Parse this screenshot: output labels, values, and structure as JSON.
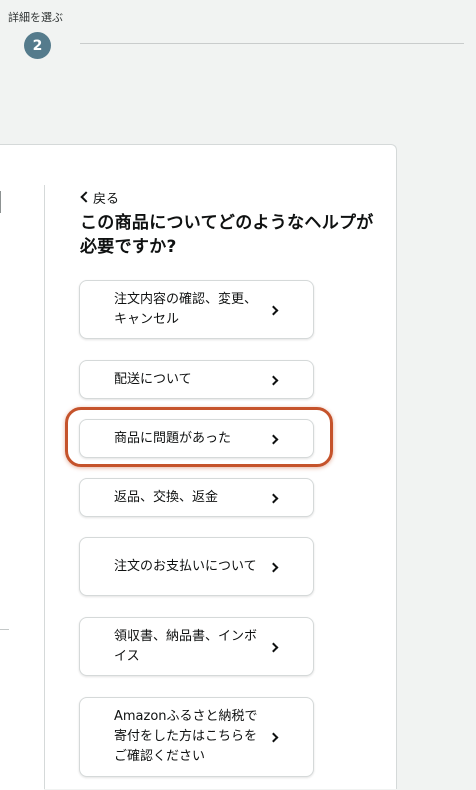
{
  "stepper": {
    "label": "詳細を選ぶ",
    "number": "2"
  },
  "help": {
    "back_label": "戻る",
    "heading": "この商品についてどのようなヘルプが必要ですか?",
    "options": [
      {
        "label": "注文内容の確認、変更、キャンセル"
      },
      {
        "label": "配送について"
      },
      {
        "label": "商品に問題があった"
      },
      {
        "label": "返品、交換、返金"
      },
      {
        "label": "注文のお支払いについて"
      },
      {
        "label": "領収書、納品書、インボイス"
      },
      {
        "label": "Amazonふるさと納税で寄付をした方はこちらをご確認ください"
      }
    ],
    "highlighted_option": "商品に問題があった"
  },
  "colors": {
    "step_circle": "#557b8c",
    "highlight_ring": "#c5532b",
    "background": "#f1f3f2"
  },
  "icons": {
    "back": "chevron-left-icon",
    "option": "chevron-right-icon"
  }
}
